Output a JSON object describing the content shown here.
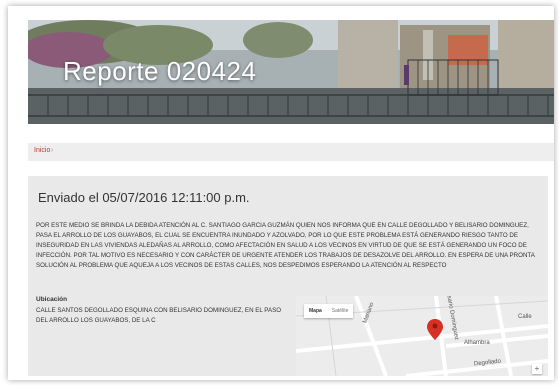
{
  "header": {
    "title": "Reporte 020424"
  },
  "breadcrumb": {
    "home": "Inicio",
    "separator": "›"
  },
  "report": {
    "sent_label": "Enviado el 05/07/2016 12:11:00 p.m.",
    "body": "POR ESTE MEDIO SE BRINDA LA DEBIDA ATENCIÓN AL C. SANTIAGO GARCIA GUZMÁN QUIEN NOS INFORMA QUE EN CALLE DEGOLLADO Y BELISARIO DOMINGUEZ, PASA EL ARROLLO DE LOS GUAYABOS, EL CUAL SE ENCUENTRA INUNDADO Y AZOLVADO, POR LO QUE ESTE PROBLEMA ESTÁ GENERANDO RIESGO TANTO DE INSEGURIDAD EN LAS VIVIENDAS ALEDAÑAS AL ARROLLO, COMO AFECTACIÓN EN SALUD A LOS VECINOS EN VIRTUD DE QUE SE ESTÁ GENERANDO UN FOCO DE INFECCIÓN. POR TAL MOTIVO ES NECESARIO Y CON CARÁCTER DE URGENTE ATENDER LOS TRABAJOS DE DESAZOLVE DEL ARROLLO. EN ESPERA DE UNA PRONTA SOLUCIÓN AL PROBLEMA QUE AQUEJA A LOS VECINOS DE ESTAS CALLES, NOS DESPEDIMOS ESPERANDO LA ATENCIÓN AL RESPECTO",
    "location_label": "Ubicación",
    "location_text": "CALLE SANTOS DEGOLLADO ESQUINA CON BELISARIO DOMINGUEZ, EN EL PASO DEL ARROLLO LOS GUAYABOS, DE LA C"
  },
  "map": {
    "tab_map": "Mapa",
    "tab_satellite": "Satélite",
    "streets": [
      "Mariano",
      "Belisario Dominguez",
      "Alhambra",
      "Calle",
      "Degollado"
    ],
    "zoom_label": "+",
    "pin_color": "#d93025"
  }
}
